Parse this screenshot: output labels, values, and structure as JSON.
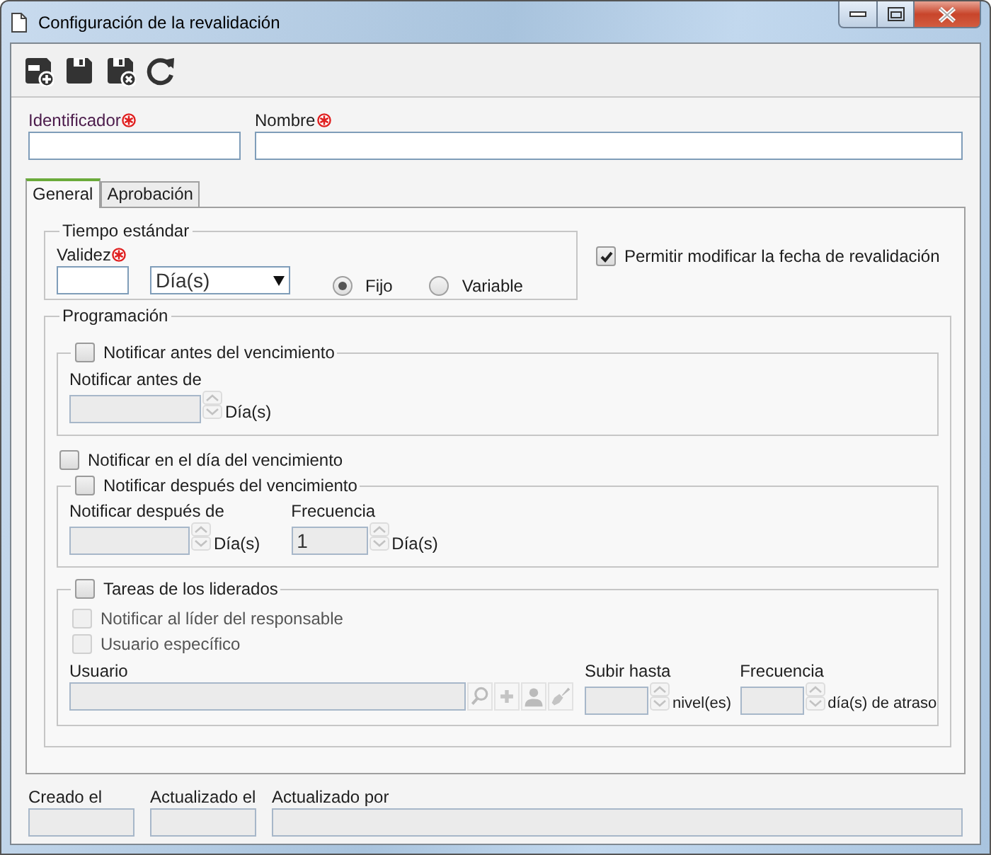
{
  "window": {
    "title": "Configuración de la revalidación"
  },
  "toolbar": [
    {
      "kind": "save_new"
    },
    {
      "kind": "save"
    },
    {
      "kind": "save_close"
    },
    {
      "kind": "refresh"
    }
  ],
  "header_fields": [
    {
      "label": "Identificador",
      "required": true,
      "disabled": false
    },
    {
      "label": "Nombre",
      "required": true,
      "disabled": false
    }
  ],
  "tabs": [
    {
      "label": "General",
      "selected": true
    },
    {
      "label": "Aprobación",
      "selected": false
    }
  ],
  "standard_time": {
    "legend": "Tiempo estándar",
    "validity": {
      "label": "Validez",
      "required": true,
      "disabled": false
    },
    "unit": {
      "value": "Día(s)"
    },
    "options": [
      {
        "label": "Fijo",
        "selected": true
      },
      {
        "label": "Variable",
        "selected": false
      }
    ]
  },
  "allow_change": {
    "label": "Permitir modificar la fecha de revalidación",
    "checked": true
  },
  "schedule": {
    "legend": "Programación",
    "before": {
      "label": "Notificar antes del vencimiento",
      "checked": false,
      "fields": [
        {
          "label": "Notificar antes de",
          "unit": "Día(s)",
          "disabled": true
        }
      ]
    },
    "on_day": {
      "label": "Notificar en el día del vencimiento",
      "checked": false
    },
    "after": {
      "label": "Notificar después del vencimiento",
      "checked": false,
      "fields": [
        {
          "label": "Notificar después de",
          "unit": "Día(s)",
          "disabled": true
        },
        {
          "label": "Frecuencia",
          "value": "1",
          "unit": "Día(s)",
          "disabled": true
        }
      ]
    },
    "subordinates": {
      "label": "Tareas de los liderados",
      "checked": false,
      "options": [
        {
          "label": "Notificar al líder del responsable",
          "checked": false,
          "disabled": true
        },
        {
          "label": "Usuario específico",
          "checked": false,
          "disabled": true
        }
      ],
      "user": {
        "label": "Usuario",
        "disabled": true,
        "buttons": [
          {
            "kind": "search"
          },
          {
            "kind": "add"
          },
          {
            "kind": "user"
          },
          {
            "kind": "clear"
          }
        ]
      },
      "fields": [
        {
          "label": "Subir hasta",
          "unit": "nivel(es)",
          "disabled": true
        },
        {
          "label": "Frecuencia",
          "unit": "día(s) de atraso",
          "disabled": true
        }
      ]
    }
  },
  "footer": [
    {
      "label": "Creado el",
      "disabled": true
    },
    {
      "label": "Actualizado el",
      "disabled": true
    },
    {
      "label": "Actualizado por",
      "disabled": true
    }
  ]
}
